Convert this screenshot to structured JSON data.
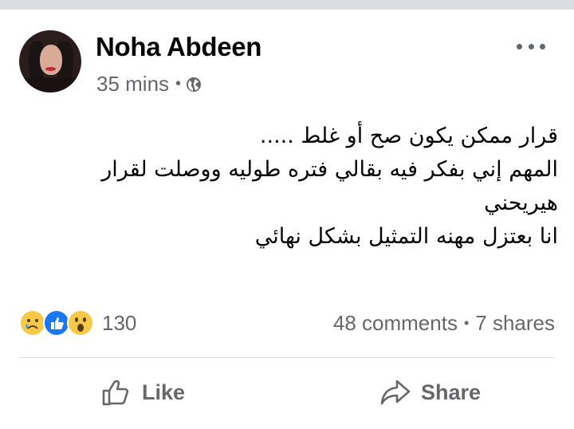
{
  "post": {
    "author": "Noha Abdeen",
    "time": "35 mins",
    "separator": "•",
    "privacy_icon": "globe-icon",
    "body_lines": [
      "قرار ممكن يكون صح أو غلط .....",
      "المهم إني بفكر فيه بقالي فتره طوليه ووصلت لقرار",
      "هيريحني",
      "انا بعتزل مهنه التمثيل بشكل نهائي"
    ]
  },
  "stats": {
    "reactions": [
      "sad-emoji",
      "like-emoji",
      "wow-emoji"
    ],
    "reaction_count": "130",
    "comments": "48 comments",
    "separator": "•",
    "shares": "7 shares"
  },
  "actions": {
    "like_label": "Like",
    "share_label": "Share"
  },
  "colors": {
    "text": "#050505",
    "secondary": "#65676b",
    "like_blue": "#1877f2",
    "emoji_yellow": "#f7c948",
    "divider": "#d6d8dc"
  }
}
